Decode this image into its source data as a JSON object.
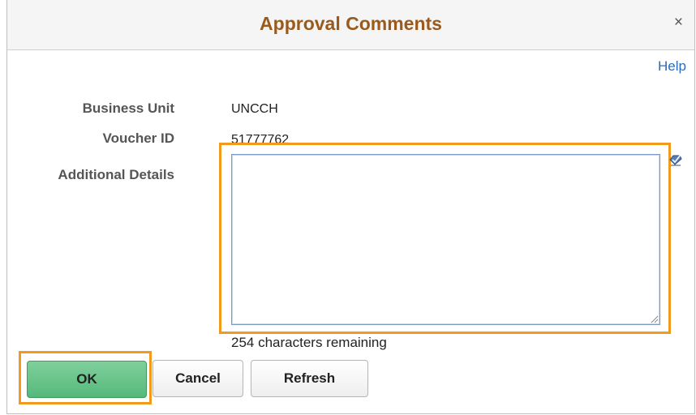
{
  "dialog": {
    "title": "Approval Comments",
    "close_symbol": "×",
    "help_label": "Help"
  },
  "fields": {
    "business_unit": {
      "label": "Business Unit",
      "value": "UNCCH"
    },
    "voucher_id": {
      "label": "Voucher ID",
      "value": "51777762"
    },
    "additional_details": {
      "label": "Additional Details",
      "value": "",
      "placeholder": ""
    }
  },
  "remaining_text": "254 characters remaining",
  "buttons": {
    "ok": "OK",
    "cancel": "Cancel",
    "refresh": "Refresh"
  },
  "colors": {
    "title": "#9a5a1e",
    "link": "#2a6ebb",
    "highlight": "#f29a1d",
    "ok_button": "#62c285"
  },
  "icons": {
    "close": "close-icon",
    "spell_check": "spell-check-icon",
    "resize": "resize-grip-icon"
  }
}
